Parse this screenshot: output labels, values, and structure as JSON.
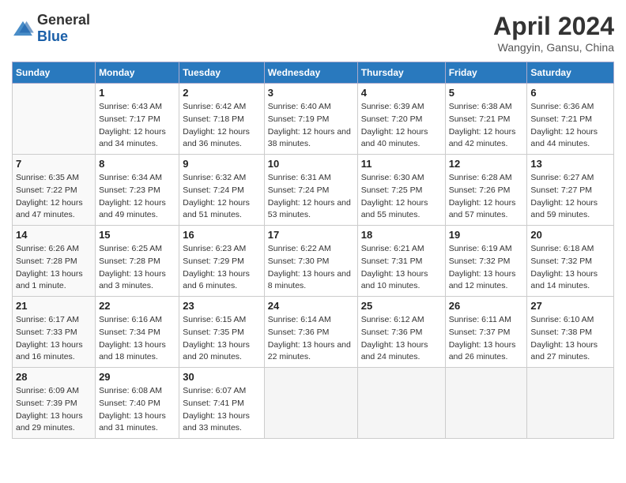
{
  "header": {
    "logo_general": "General",
    "logo_blue": "Blue",
    "title": "April 2024",
    "subtitle": "Wangyin, Gansu, China"
  },
  "columns": [
    "Sunday",
    "Monday",
    "Tuesday",
    "Wednesday",
    "Thursday",
    "Friday",
    "Saturday"
  ],
  "weeks": [
    [
      {
        "day": "",
        "sunrise": "",
        "sunset": "",
        "daylight": ""
      },
      {
        "day": "1",
        "sunrise": "Sunrise: 6:43 AM",
        "sunset": "Sunset: 7:17 PM",
        "daylight": "Daylight: 12 hours and 34 minutes."
      },
      {
        "day": "2",
        "sunrise": "Sunrise: 6:42 AM",
        "sunset": "Sunset: 7:18 PM",
        "daylight": "Daylight: 12 hours and 36 minutes."
      },
      {
        "day": "3",
        "sunrise": "Sunrise: 6:40 AM",
        "sunset": "Sunset: 7:19 PM",
        "daylight": "Daylight: 12 hours and 38 minutes."
      },
      {
        "day": "4",
        "sunrise": "Sunrise: 6:39 AM",
        "sunset": "Sunset: 7:20 PM",
        "daylight": "Daylight: 12 hours and 40 minutes."
      },
      {
        "day": "5",
        "sunrise": "Sunrise: 6:38 AM",
        "sunset": "Sunset: 7:21 PM",
        "daylight": "Daylight: 12 hours and 42 minutes."
      },
      {
        "day": "6",
        "sunrise": "Sunrise: 6:36 AM",
        "sunset": "Sunset: 7:21 PM",
        "daylight": "Daylight: 12 hours and 44 minutes."
      }
    ],
    [
      {
        "day": "7",
        "sunrise": "Sunrise: 6:35 AM",
        "sunset": "Sunset: 7:22 PM",
        "daylight": "Daylight: 12 hours and 47 minutes."
      },
      {
        "day": "8",
        "sunrise": "Sunrise: 6:34 AM",
        "sunset": "Sunset: 7:23 PM",
        "daylight": "Daylight: 12 hours and 49 minutes."
      },
      {
        "day": "9",
        "sunrise": "Sunrise: 6:32 AM",
        "sunset": "Sunset: 7:24 PM",
        "daylight": "Daylight: 12 hours and 51 minutes."
      },
      {
        "day": "10",
        "sunrise": "Sunrise: 6:31 AM",
        "sunset": "Sunset: 7:24 PM",
        "daylight": "Daylight: 12 hours and 53 minutes."
      },
      {
        "day": "11",
        "sunrise": "Sunrise: 6:30 AM",
        "sunset": "Sunset: 7:25 PM",
        "daylight": "Daylight: 12 hours and 55 minutes."
      },
      {
        "day": "12",
        "sunrise": "Sunrise: 6:28 AM",
        "sunset": "Sunset: 7:26 PM",
        "daylight": "Daylight: 12 hours and 57 minutes."
      },
      {
        "day": "13",
        "sunrise": "Sunrise: 6:27 AM",
        "sunset": "Sunset: 7:27 PM",
        "daylight": "Daylight: 12 hours and 59 minutes."
      }
    ],
    [
      {
        "day": "14",
        "sunrise": "Sunrise: 6:26 AM",
        "sunset": "Sunset: 7:28 PM",
        "daylight": "Daylight: 13 hours and 1 minute."
      },
      {
        "day": "15",
        "sunrise": "Sunrise: 6:25 AM",
        "sunset": "Sunset: 7:28 PM",
        "daylight": "Daylight: 13 hours and 3 minutes."
      },
      {
        "day": "16",
        "sunrise": "Sunrise: 6:23 AM",
        "sunset": "Sunset: 7:29 PM",
        "daylight": "Daylight: 13 hours and 6 minutes."
      },
      {
        "day": "17",
        "sunrise": "Sunrise: 6:22 AM",
        "sunset": "Sunset: 7:30 PM",
        "daylight": "Daylight: 13 hours and 8 minutes."
      },
      {
        "day": "18",
        "sunrise": "Sunrise: 6:21 AM",
        "sunset": "Sunset: 7:31 PM",
        "daylight": "Daylight: 13 hours and 10 minutes."
      },
      {
        "day": "19",
        "sunrise": "Sunrise: 6:19 AM",
        "sunset": "Sunset: 7:32 PM",
        "daylight": "Daylight: 13 hours and 12 minutes."
      },
      {
        "day": "20",
        "sunrise": "Sunrise: 6:18 AM",
        "sunset": "Sunset: 7:32 PM",
        "daylight": "Daylight: 13 hours and 14 minutes."
      }
    ],
    [
      {
        "day": "21",
        "sunrise": "Sunrise: 6:17 AM",
        "sunset": "Sunset: 7:33 PM",
        "daylight": "Daylight: 13 hours and 16 minutes."
      },
      {
        "day": "22",
        "sunrise": "Sunrise: 6:16 AM",
        "sunset": "Sunset: 7:34 PM",
        "daylight": "Daylight: 13 hours and 18 minutes."
      },
      {
        "day": "23",
        "sunrise": "Sunrise: 6:15 AM",
        "sunset": "Sunset: 7:35 PM",
        "daylight": "Daylight: 13 hours and 20 minutes."
      },
      {
        "day": "24",
        "sunrise": "Sunrise: 6:14 AM",
        "sunset": "Sunset: 7:36 PM",
        "daylight": "Daylight: 13 hours and 22 minutes."
      },
      {
        "day": "25",
        "sunrise": "Sunrise: 6:12 AM",
        "sunset": "Sunset: 7:36 PM",
        "daylight": "Daylight: 13 hours and 24 minutes."
      },
      {
        "day": "26",
        "sunrise": "Sunrise: 6:11 AM",
        "sunset": "Sunset: 7:37 PM",
        "daylight": "Daylight: 13 hours and 26 minutes."
      },
      {
        "day": "27",
        "sunrise": "Sunrise: 6:10 AM",
        "sunset": "Sunset: 7:38 PM",
        "daylight": "Daylight: 13 hours and 27 minutes."
      }
    ],
    [
      {
        "day": "28",
        "sunrise": "Sunrise: 6:09 AM",
        "sunset": "Sunset: 7:39 PM",
        "daylight": "Daylight: 13 hours and 29 minutes."
      },
      {
        "day": "29",
        "sunrise": "Sunrise: 6:08 AM",
        "sunset": "Sunset: 7:40 PM",
        "daylight": "Daylight: 13 hours and 31 minutes."
      },
      {
        "day": "30",
        "sunrise": "Sunrise: 6:07 AM",
        "sunset": "Sunset: 7:41 PM",
        "daylight": "Daylight: 13 hours and 33 minutes."
      },
      {
        "day": "",
        "sunrise": "",
        "sunset": "",
        "daylight": ""
      },
      {
        "day": "",
        "sunrise": "",
        "sunset": "",
        "daylight": ""
      },
      {
        "day": "",
        "sunrise": "",
        "sunset": "",
        "daylight": ""
      },
      {
        "day": "",
        "sunrise": "",
        "sunset": "",
        "daylight": ""
      }
    ]
  ]
}
